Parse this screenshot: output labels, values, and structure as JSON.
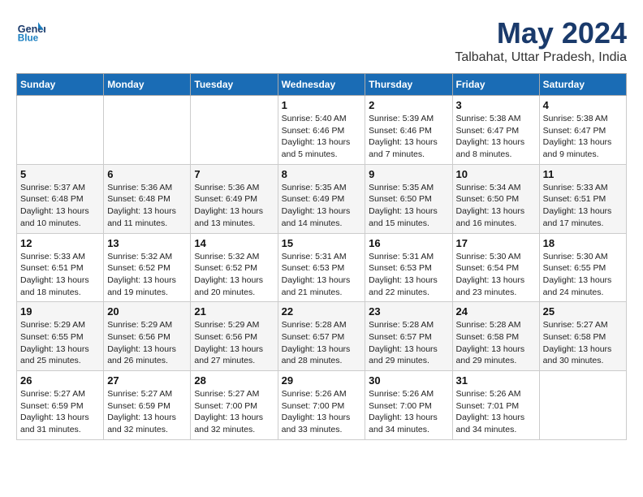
{
  "logo": {
    "text_general": "General",
    "text_blue": "Blue"
  },
  "title": "May 2024",
  "location": "Talbahat, Uttar Pradesh, India",
  "weekdays": [
    "Sunday",
    "Monday",
    "Tuesday",
    "Wednesday",
    "Thursday",
    "Friday",
    "Saturday"
  ],
  "weeks": [
    [
      null,
      null,
      null,
      {
        "day": 1,
        "sunrise": "5:40 AM",
        "sunset": "6:46 PM",
        "daylight": "13 hours and 5 minutes."
      },
      {
        "day": 2,
        "sunrise": "5:39 AM",
        "sunset": "6:46 PM",
        "daylight": "13 hours and 7 minutes."
      },
      {
        "day": 3,
        "sunrise": "5:38 AM",
        "sunset": "6:47 PM",
        "daylight": "13 hours and 8 minutes."
      },
      {
        "day": 4,
        "sunrise": "5:38 AM",
        "sunset": "6:47 PM",
        "daylight": "13 hours and 9 minutes."
      }
    ],
    [
      {
        "day": 5,
        "sunrise": "5:37 AM",
        "sunset": "6:48 PM",
        "daylight": "13 hours and 10 minutes."
      },
      {
        "day": 6,
        "sunrise": "5:36 AM",
        "sunset": "6:48 PM",
        "daylight": "13 hours and 11 minutes."
      },
      {
        "day": 7,
        "sunrise": "5:36 AM",
        "sunset": "6:49 PM",
        "daylight": "13 hours and 13 minutes."
      },
      {
        "day": 8,
        "sunrise": "5:35 AM",
        "sunset": "6:49 PM",
        "daylight": "13 hours and 14 minutes."
      },
      {
        "day": 9,
        "sunrise": "5:35 AM",
        "sunset": "6:50 PM",
        "daylight": "13 hours and 15 minutes."
      },
      {
        "day": 10,
        "sunrise": "5:34 AM",
        "sunset": "6:50 PM",
        "daylight": "13 hours and 16 minutes."
      },
      {
        "day": 11,
        "sunrise": "5:33 AM",
        "sunset": "6:51 PM",
        "daylight": "13 hours and 17 minutes."
      }
    ],
    [
      {
        "day": 12,
        "sunrise": "5:33 AM",
        "sunset": "6:51 PM",
        "daylight": "13 hours and 18 minutes."
      },
      {
        "day": 13,
        "sunrise": "5:32 AM",
        "sunset": "6:52 PM",
        "daylight": "13 hours and 19 minutes."
      },
      {
        "day": 14,
        "sunrise": "5:32 AM",
        "sunset": "6:52 PM",
        "daylight": "13 hours and 20 minutes."
      },
      {
        "day": 15,
        "sunrise": "5:31 AM",
        "sunset": "6:53 PM",
        "daylight": "13 hours and 21 minutes."
      },
      {
        "day": 16,
        "sunrise": "5:31 AM",
        "sunset": "6:53 PM",
        "daylight": "13 hours and 22 minutes."
      },
      {
        "day": 17,
        "sunrise": "5:30 AM",
        "sunset": "6:54 PM",
        "daylight": "13 hours and 23 minutes."
      },
      {
        "day": 18,
        "sunrise": "5:30 AM",
        "sunset": "6:55 PM",
        "daylight": "13 hours and 24 minutes."
      }
    ],
    [
      {
        "day": 19,
        "sunrise": "5:29 AM",
        "sunset": "6:55 PM",
        "daylight": "13 hours and 25 minutes."
      },
      {
        "day": 20,
        "sunrise": "5:29 AM",
        "sunset": "6:56 PM",
        "daylight": "13 hours and 26 minutes."
      },
      {
        "day": 21,
        "sunrise": "5:29 AM",
        "sunset": "6:56 PM",
        "daylight": "13 hours and 27 minutes."
      },
      {
        "day": 22,
        "sunrise": "5:28 AM",
        "sunset": "6:57 PM",
        "daylight": "13 hours and 28 minutes."
      },
      {
        "day": 23,
        "sunrise": "5:28 AM",
        "sunset": "6:57 PM",
        "daylight": "13 hours and 29 minutes."
      },
      {
        "day": 24,
        "sunrise": "5:28 AM",
        "sunset": "6:58 PM",
        "daylight": "13 hours and 29 minutes."
      },
      {
        "day": 25,
        "sunrise": "5:27 AM",
        "sunset": "6:58 PM",
        "daylight": "13 hours and 30 minutes."
      }
    ],
    [
      {
        "day": 26,
        "sunrise": "5:27 AM",
        "sunset": "6:59 PM",
        "daylight": "13 hours and 31 minutes."
      },
      {
        "day": 27,
        "sunrise": "5:27 AM",
        "sunset": "6:59 PM",
        "daylight": "13 hours and 32 minutes."
      },
      {
        "day": 28,
        "sunrise": "5:27 AM",
        "sunset": "7:00 PM",
        "daylight": "13 hours and 32 minutes."
      },
      {
        "day": 29,
        "sunrise": "5:26 AM",
        "sunset": "7:00 PM",
        "daylight": "13 hours and 33 minutes."
      },
      {
        "day": 30,
        "sunrise": "5:26 AM",
        "sunset": "7:00 PM",
        "daylight": "13 hours and 34 minutes."
      },
      {
        "day": 31,
        "sunrise": "5:26 AM",
        "sunset": "7:01 PM",
        "daylight": "13 hours and 34 minutes."
      },
      null
    ]
  ]
}
